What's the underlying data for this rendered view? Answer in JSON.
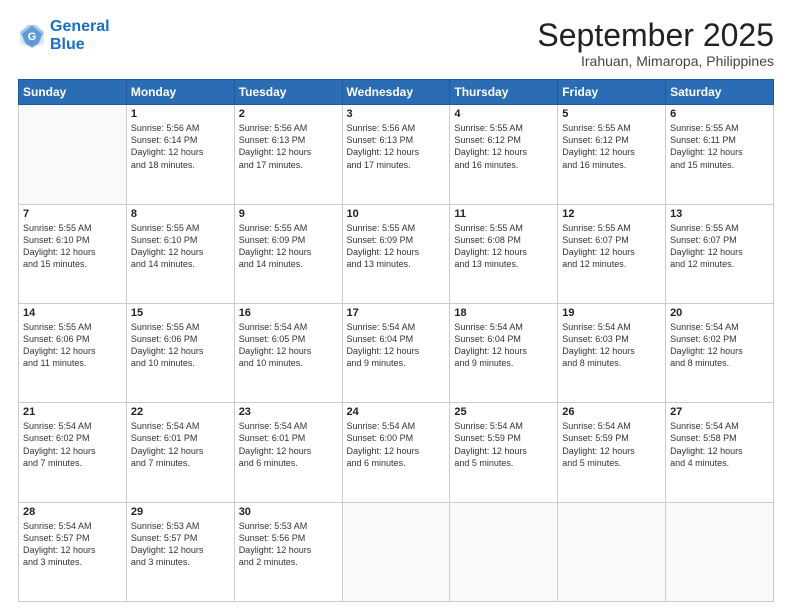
{
  "header": {
    "logo_line1": "General",
    "logo_line2": "Blue",
    "month": "September 2025",
    "location": "Irahuan, Mimaropa, Philippines"
  },
  "weekdays": [
    "Sunday",
    "Monday",
    "Tuesday",
    "Wednesday",
    "Thursday",
    "Friday",
    "Saturday"
  ],
  "weeks": [
    [
      {
        "day": "",
        "info": ""
      },
      {
        "day": "1",
        "info": "Sunrise: 5:56 AM\nSunset: 6:14 PM\nDaylight: 12 hours\nand 18 minutes."
      },
      {
        "day": "2",
        "info": "Sunrise: 5:56 AM\nSunset: 6:13 PM\nDaylight: 12 hours\nand 17 minutes."
      },
      {
        "day": "3",
        "info": "Sunrise: 5:56 AM\nSunset: 6:13 PM\nDaylight: 12 hours\nand 17 minutes."
      },
      {
        "day": "4",
        "info": "Sunrise: 5:55 AM\nSunset: 6:12 PM\nDaylight: 12 hours\nand 16 minutes."
      },
      {
        "day": "5",
        "info": "Sunrise: 5:55 AM\nSunset: 6:12 PM\nDaylight: 12 hours\nand 16 minutes."
      },
      {
        "day": "6",
        "info": "Sunrise: 5:55 AM\nSunset: 6:11 PM\nDaylight: 12 hours\nand 15 minutes."
      }
    ],
    [
      {
        "day": "7",
        "info": "Sunrise: 5:55 AM\nSunset: 6:10 PM\nDaylight: 12 hours\nand 15 minutes."
      },
      {
        "day": "8",
        "info": "Sunrise: 5:55 AM\nSunset: 6:10 PM\nDaylight: 12 hours\nand 14 minutes."
      },
      {
        "day": "9",
        "info": "Sunrise: 5:55 AM\nSunset: 6:09 PM\nDaylight: 12 hours\nand 14 minutes."
      },
      {
        "day": "10",
        "info": "Sunrise: 5:55 AM\nSunset: 6:09 PM\nDaylight: 12 hours\nand 13 minutes."
      },
      {
        "day": "11",
        "info": "Sunrise: 5:55 AM\nSunset: 6:08 PM\nDaylight: 12 hours\nand 13 minutes."
      },
      {
        "day": "12",
        "info": "Sunrise: 5:55 AM\nSunset: 6:07 PM\nDaylight: 12 hours\nand 12 minutes."
      },
      {
        "day": "13",
        "info": "Sunrise: 5:55 AM\nSunset: 6:07 PM\nDaylight: 12 hours\nand 12 minutes."
      }
    ],
    [
      {
        "day": "14",
        "info": "Sunrise: 5:55 AM\nSunset: 6:06 PM\nDaylight: 12 hours\nand 11 minutes."
      },
      {
        "day": "15",
        "info": "Sunrise: 5:55 AM\nSunset: 6:06 PM\nDaylight: 12 hours\nand 10 minutes."
      },
      {
        "day": "16",
        "info": "Sunrise: 5:54 AM\nSunset: 6:05 PM\nDaylight: 12 hours\nand 10 minutes."
      },
      {
        "day": "17",
        "info": "Sunrise: 5:54 AM\nSunset: 6:04 PM\nDaylight: 12 hours\nand 9 minutes."
      },
      {
        "day": "18",
        "info": "Sunrise: 5:54 AM\nSunset: 6:04 PM\nDaylight: 12 hours\nand 9 minutes."
      },
      {
        "day": "19",
        "info": "Sunrise: 5:54 AM\nSunset: 6:03 PM\nDaylight: 12 hours\nand 8 minutes."
      },
      {
        "day": "20",
        "info": "Sunrise: 5:54 AM\nSunset: 6:02 PM\nDaylight: 12 hours\nand 8 minutes."
      }
    ],
    [
      {
        "day": "21",
        "info": "Sunrise: 5:54 AM\nSunset: 6:02 PM\nDaylight: 12 hours\nand 7 minutes."
      },
      {
        "day": "22",
        "info": "Sunrise: 5:54 AM\nSunset: 6:01 PM\nDaylight: 12 hours\nand 7 minutes."
      },
      {
        "day": "23",
        "info": "Sunrise: 5:54 AM\nSunset: 6:01 PM\nDaylight: 12 hours\nand 6 minutes."
      },
      {
        "day": "24",
        "info": "Sunrise: 5:54 AM\nSunset: 6:00 PM\nDaylight: 12 hours\nand 6 minutes."
      },
      {
        "day": "25",
        "info": "Sunrise: 5:54 AM\nSunset: 5:59 PM\nDaylight: 12 hours\nand 5 minutes."
      },
      {
        "day": "26",
        "info": "Sunrise: 5:54 AM\nSunset: 5:59 PM\nDaylight: 12 hours\nand 5 minutes."
      },
      {
        "day": "27",
        "info": "Sunrise: 5:54 AM\nSunset: 5:58 PM\nDaylight: 12 hours\nand 4 minutes."
      }
    ],
    [
      {
        "day": "28",
        "info": "Sunrise: 5:54 AM\nSunset: 5:57 PM\nDaylight: 12 hours\nand 3 minutes."
      },
      {
        "day": "29",
        "info": "Sunrise: 5:53 AM\nSunset: 5:57 PM\nDaylight: 12 hours\nand 3 minutes."
      },
      {
        "day": "30",
        "info": "Sunrise: 5:53 AM\nSunset: 5:56 PM\nDaylight: 12 hours\nand 2 minutes."
      },
      {
        "day": "",
        "info": ""
      },
      {
        "day": "",
        "info": ""
      },
      {
        "day": "",
        "info": ""
      },
      {
        "day": "",
        "info": ""
      }
    ]
  ]
}
